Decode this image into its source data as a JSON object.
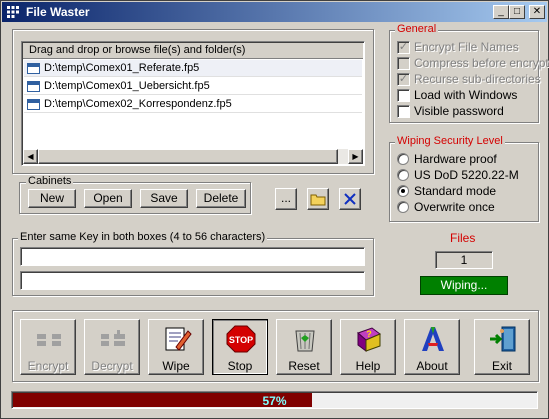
{
  "window": {
    "title": "File Waster",
    "controls": {
      "minimize": "_",
      "maximize": "□",
      "close": "✕"
    }
  },
  "files_list": {
    "header": "Drag and drop or browse file(s) and folder(s)",
    "items": [
      "D:\\temp\\Comex01_Referate.fp5",
      "D:\\temp\\Comex01_Uebersicht.fp5",
      "D:\\temp\\Comex02_Korrespondenz.fp5"
    ],
    "scroll_left": "◀",
    "scroll_right": "▶"
  },
  "cabinets": {
    "label": "Cabinets",
    "new": "New",
    "open": "Open",
    "save": "Save",
    "delete": "Delete"
  },
  "browse": {
    "ellipsis": "...",
    "folder_icon": "folder-icon",
    "remove_icon": "x-icon"
  },
  "general": {
    "label": "General",
    "options": [
      {
        "label": "Encrypt File Names",
        "checked": true,
        "disabled": true
      },
      {
        "label": "Compress before encrypt",
        "checked": false,
        "disabled": true
      },
      {
        "label": "Recurse sub-directories",
        "checked": true,
        "disabled": true
      },
      {
        "label": "Load with Windows",
        "checked": false,
        "disabled": false
      },
      {
        "label": "Visible password",
        "checked": false,
        "disabled": false
      }
    ]
  },
  "wiping": {
    "label": "Wiping Security Level",
    "options": [
      {
        "label": "Hardware proof",
        "selected": false
      },
      {
        "label": "US DoD 5220.22-M",
        "selected": false
      },
      {
        "label": "Standard mode",
        "selected": true
      },
      {
        "label": "Overwrite once",
        "selected": false
      }
    ]
  },
  "key": {
    "label": "Enter same Key in both boxes (4 to 56 characters)",
    "value1": "",
    "value2": ""
  },
  "files_count": {
    "label": "Files",
    "value": "1",
    "status": "Wiping..."
  },
  "actions": {
    "encrypt": "Encrypt",
    "decrypt": "Decrypt",
    "wipe": "Wipe",
    "stop": "Stop",
    "stop_sign": "STOP",
    "reset": "Reset",
    "help": "Help",
    "about": "About",
    "exit": "Exit"
  },
  "progress": {
    "value": 0.57,
    "text": "57%"
  },
  "colors": {
    "accent_red": "#d40000",
    "status_green": "#008000",
    "progress_fill": "#800000"
  }
}
